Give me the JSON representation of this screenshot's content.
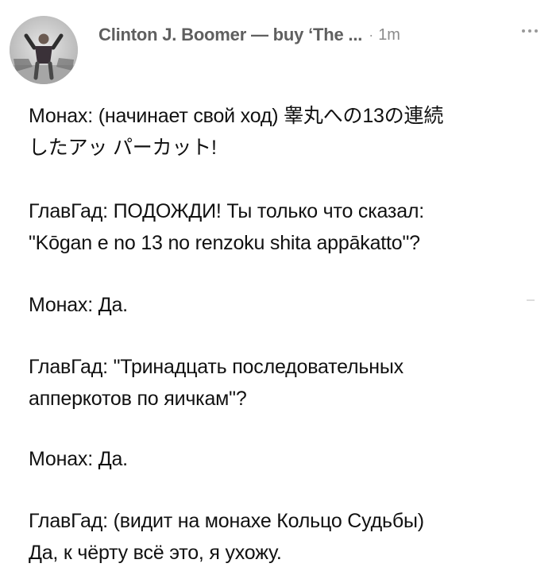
{
  "post": {
    "author": "Clinton J. Boomer — buy ‘The ...",
    "separator": "·",
    "timestamp": "1m",
    "more_icon": "more-horizontal-icon",
    "avatar_icon": "profile-photo-avatar",
    "messages": [
      {
        "lines": [
          "Монах: (начинает свой ход) 睾丸への13の連続",
          "したアッ パーカット!"
        ]
      },
      {
        "lines": [
          "ГлавГад: ПОДОЖДИ! Ты только что сказал:",
          "\"Kōgan e no 13 no renzoku shita appākatto\"?"
        ]
      },
      {
        "lines": [
          "Монах: Да."
        ]
      },
      {
        "lines": [
          "ГлавГад: \"Тринадцать последовательных",
          "апперкотов по яичкам\"?"
        ]
      },
      {
        "lines": [
          "Монах: Да."
        ]
      },
      {
        "lines": [
          "ГлавГад: (видит на монахе Кольцо Судьбы)",
          "Да, к чёрту всё это, я ухожу."
        ]
      }
    ]
  }
}
